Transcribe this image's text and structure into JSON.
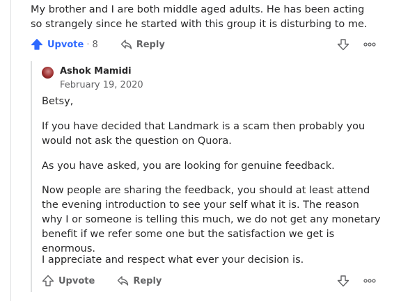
{
  "parent_comment": {
    "text": "My brother and I are both middle aged adults. He has been acting so strangely since he started with this group it is disturbing to me.",
    "upvote_label": "Upvote",
    "upvote_count": "8",
    "reply_label": "Reply"
  },
  "reply_comment": {
    "author": "Ashok Mamidi",
    "date": "February 19, 2020",
    "paragraphs": [
      "Betsy,",
      "If you have decided that Landmark is a scam then probably you would not ask the question on Quora.",
      "As you have asked, you are looking for genuine feedback.",
      "Now people are sharing the feedback, you should at least attend the evening introduction to see your self what it is. The reason why I or someone is telling this much, we do not get any monetary benefit if we refer some one but the satisfaction we get is enormous.",
      "I appreciate and respect what ever your decision is."
    ],
    "upvote_label": "Upvote",
    "reply_label": "Reply"
  },
  "colors": {
    "accent": "#2e69ff",
    "text": "#282829",
    "muted": "#636466",
    "divider": "#dee0e1"
  },
  "icons": [
    "upvote-icon",
    "reply-icon",
    "downvote-icon",
    "more-options-icon",
    "avatar"
  ]
}
